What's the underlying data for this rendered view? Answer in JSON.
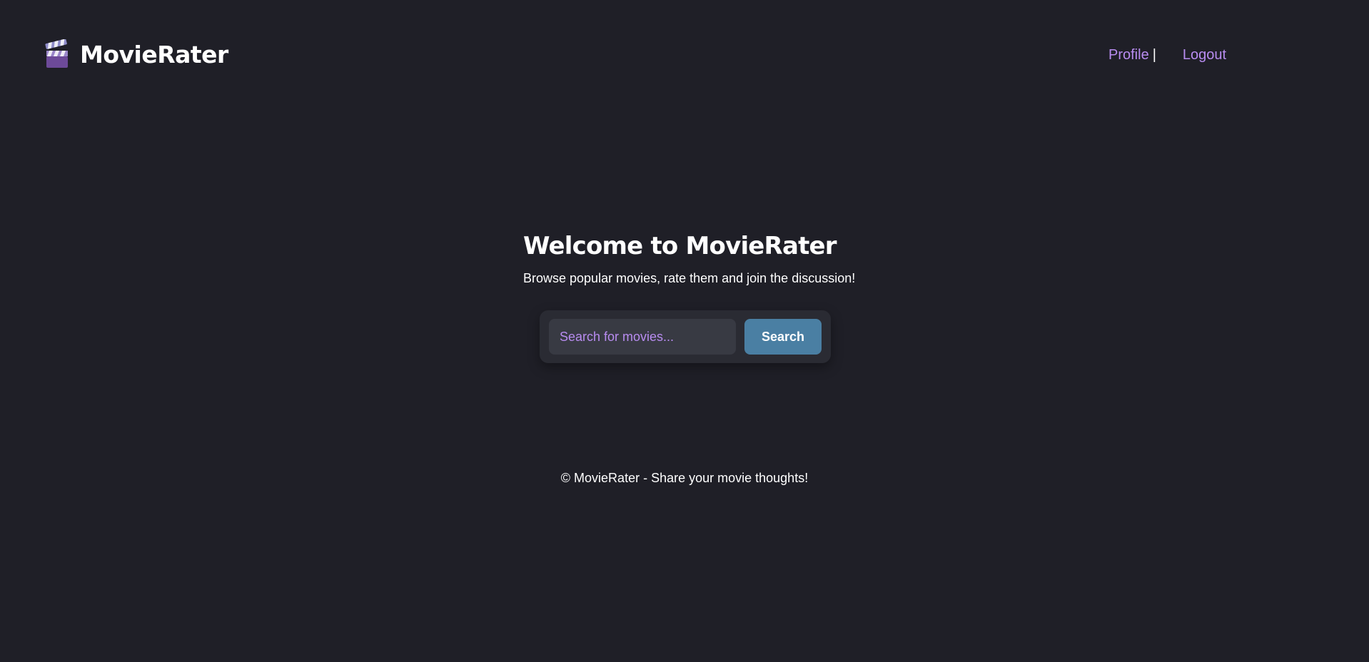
{
  "header": {
    "logo_icon": "clapperboard-icon",
    "logo_text": "MovieRater",
    "nav": {
      "profile_label": "Profile",
      "separator": "|",
      "logout_label": "Logout"
    }
  },
  "hero": {
    "title": "Welcome to MovieRater",
    "subtitle": "Browse popular movies, rate them and join the discussion!"
  },
  "search": {
    "placeholder": "Search for movies...",
    "value": "",
    "button_label": "Search"
  },
  "footer": {
    "text": "© MovieRater - Share your movie thoughts!"
  },
  "colors": {
    "background": "#1f1f27",
    "accent": "#b88cf0",
    "button": "#4a7fa3",
    "panel": "#2a2b33",
    "input": "#383a43"
  }
}
